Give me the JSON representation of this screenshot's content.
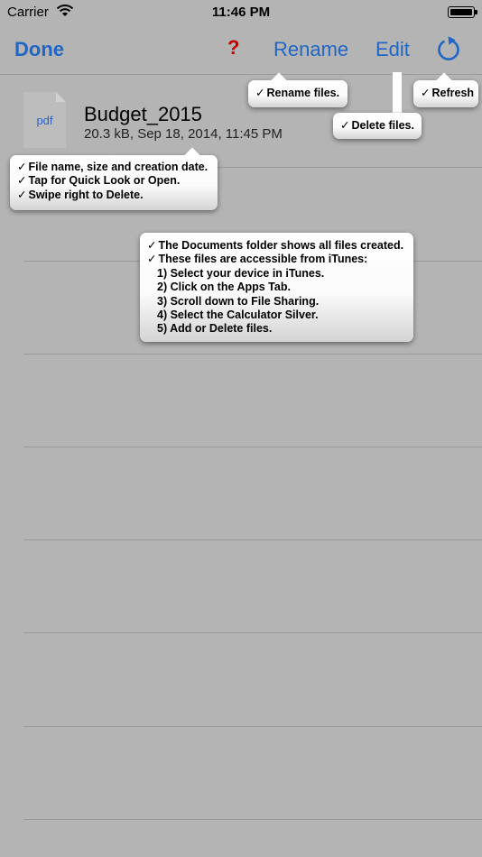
{
  "status": {
    "carrier": "Carrier",
    "time": "11:46 PM"
  },
  "nav": {
    "done": "Done",
    "help": "?",
    "rename": "Rename",
    "edit": "Edit"
  },
  "file": {
    "icon_label": "pdf",
    "name": "Budget_2015",
    "meta": "20.3 kB, Sep 18, 2014, 11:45 PM"
  },
  "tips": {
    "rename": "Rename files.",
    "delete": "Delete files.",
    "refresh": "Refresh",
    "file": [
      "File name, size and creation date.",
      "Tap for Quick Look or Open.",
      "Swipe right to Delete."
    ],
    "docs_head": [
      "The Documents folder shows all files created.",
      "These files are accessible from iTunes:"
    ],
    "docs_steps": [
      "1) Select your device in iTunes.",
      "2) Click on the Apps Tab.",
      "3) Scroll down to File Sharing.",
      "4) Select the Calculator Silver.",
      "5) Add or Delete files."
    ]
  },
  "colors": {
    "accent": "#1f66c6",
    "help": "#c40000",
    "background": "#b4b4b4"
  }
}
